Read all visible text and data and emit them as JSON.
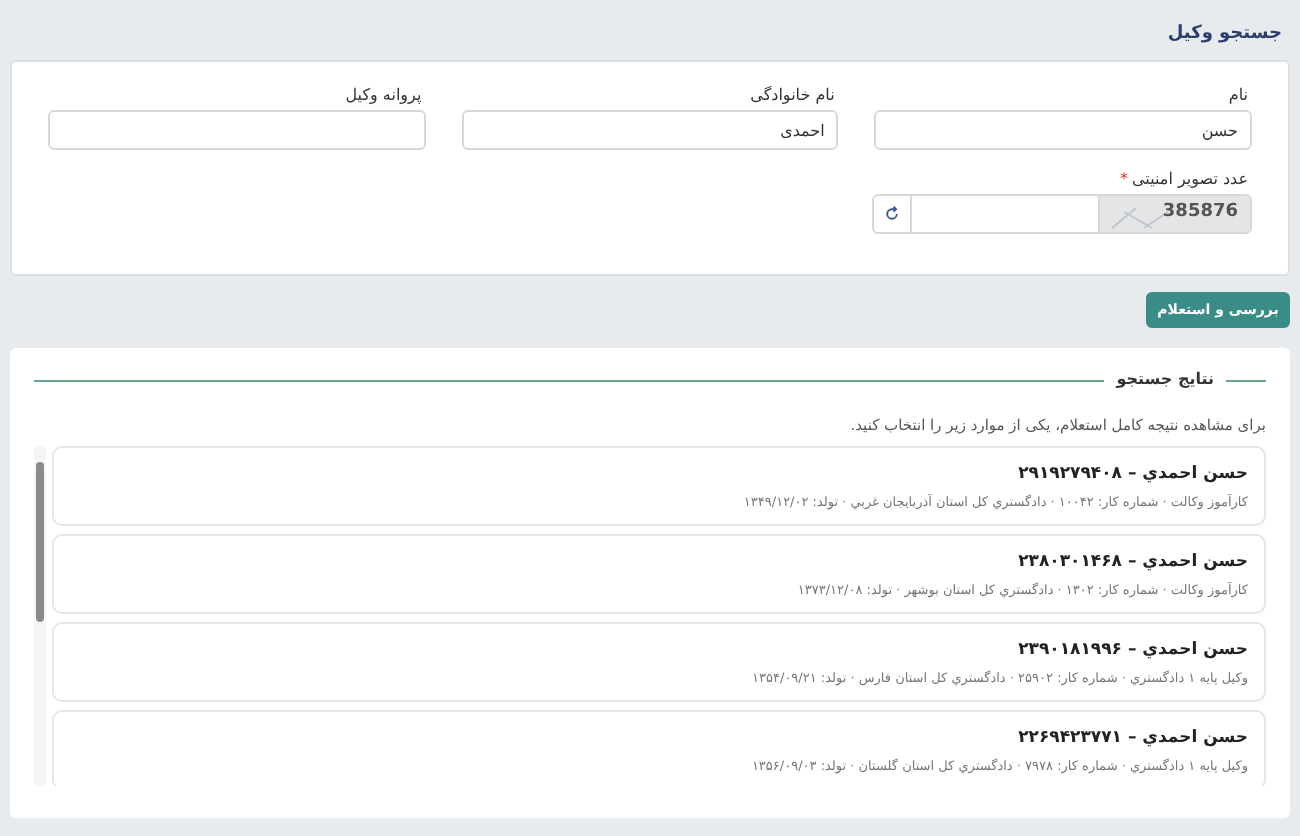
{
  "page_title": "جستجو وکیل",
  "fields": [
    {
      "label": "نام",
      "value": "حسن"
    },
    {
      "label": "نام خانوادگی",
      "value": "احمدی"
    },
    {
      "label": "پروانه وکیل"
    }
  ],
  "captcha": {
    "label": "عدد تصویر امنیتی",
    "required": true,
    "required_mark": "*",
    "code": "385876"
  },
  "submit_button": "بررسی و استعلام",
  "results": {
    "title": "نتایج جستجو",
    "hint": "برای مشاهده نتیجه کامل استعلام، یکی از موارد زیر را انتخاب کنید.",
    "items": [
      {
        "title": "حسن احمدي – ۲۹۱۹۲۷۹۴۰۸",
        "details": "کارآموز وکالت · شماره کار: ۱۰۰۴۲ · دادگستري کل استان آذربايجان غربي · تولد: ۱۳۴۹/۱۲/۰۲"
      },
      {
        "title": "حسن احمدي – ۲۳۸۰۳۰۱۴۶۸",
        "details": "کارآموز وکالت · شماره کار: ۱۳۰۲ · دادگستري کل استان بوشهر · تولد: ۱۳۷۳/۱۲/۰۸"
      },
      {
        "title": "حسن احمدي – ۲۳۹۰۱۸۱۹۹۶",
        "details": "وکيل پايه ۱ دادگستري · شماره کار: ۲۵۹۰۲ · دادگستري کل استان فارس · تولد: ۱۳۵۴/۰۹/۲۱"
      },
      {
        "title": "حسن احمدي – ۲۲۶۹۴۲۳۷۷۱",
        "details": "وکيل پايه ۱ دادگستري · شماره کار: ۷۹۷۸ · دادگستري کل استان گلستان · تولد: ۱۳۵۶/۰۹/۰۳"
      }
    ]
  }
}
